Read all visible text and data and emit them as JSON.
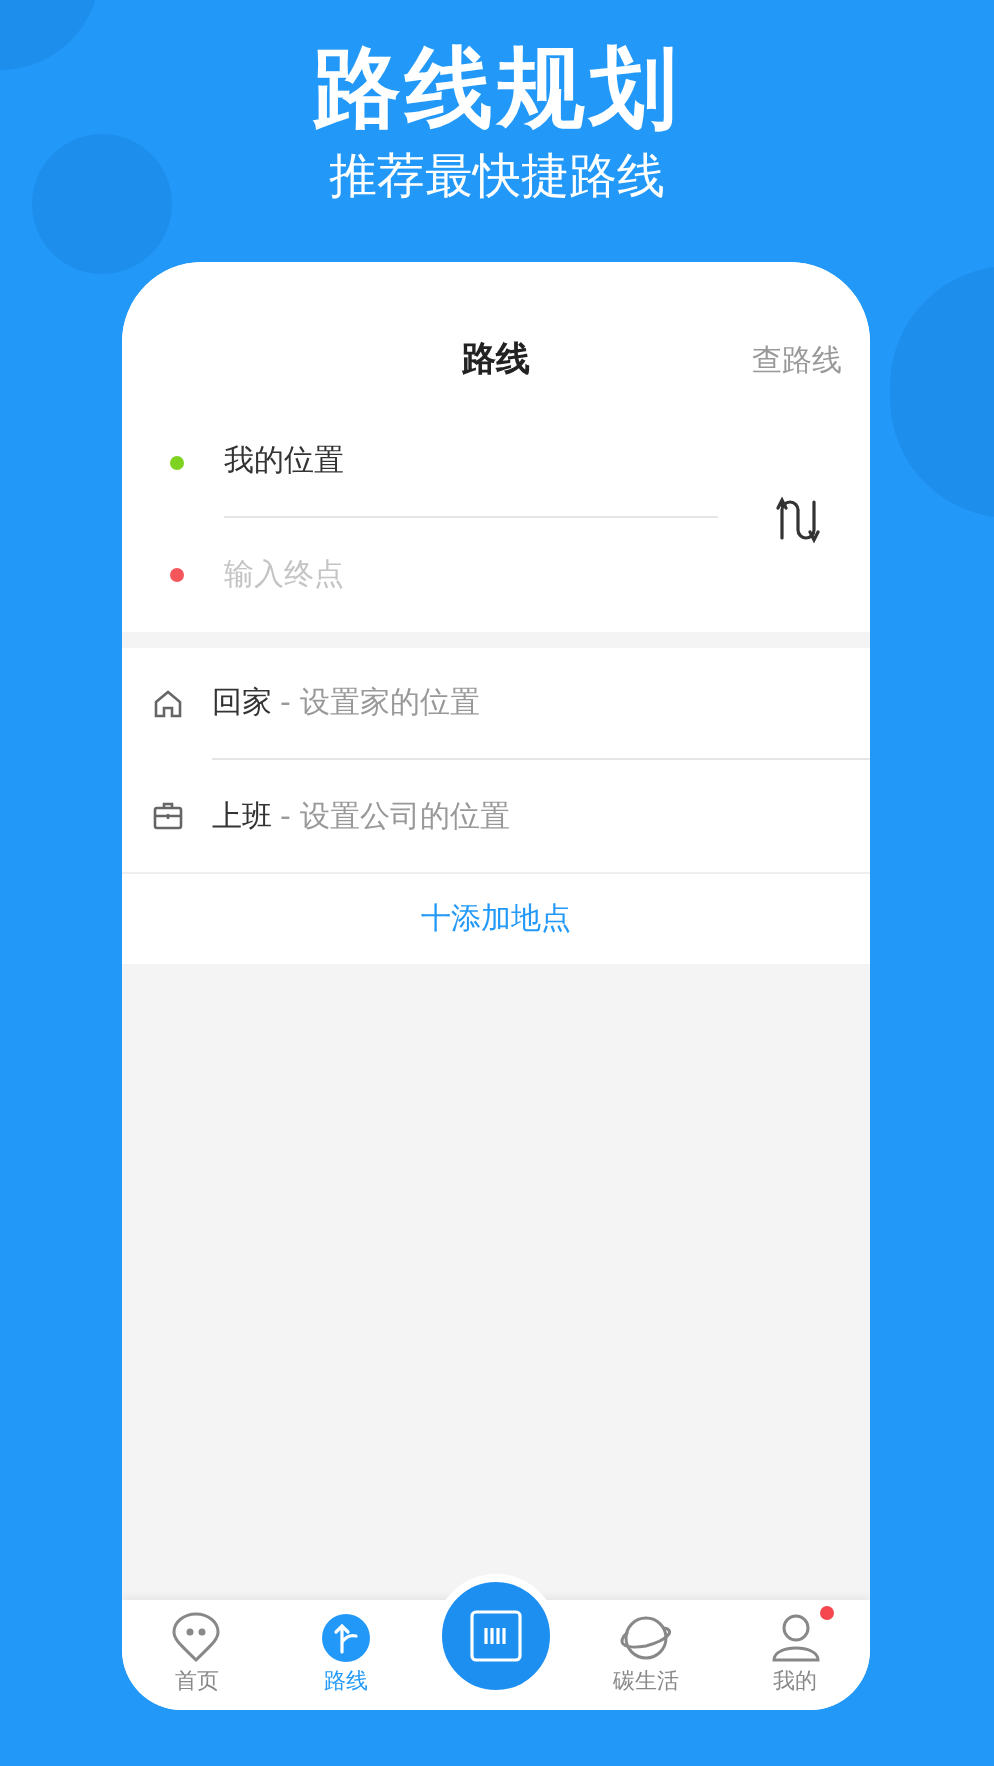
{
  "promo": {
    "title": "路线规划",
    "subtitle": "推荐最快捷路线"
  },
  "header": {
    "title": "路线",
    "action": "查路线"
  },
  "route": {
    "origin": {
      "value": "我的位置",
      "color": "#7ed321"
    },
    "destination": {
      "placeholder": "输入终点",
      "color": "#f5565b"
    }
  },
  "places": [
    {
      "kind": "home",
      "name": "回家",
      "hint": "- 设置家的位置"
    },
    {
      "kind": "work",
      "name": "上班",
      "hint": "- 设置公司的位置"
    }
  ],
  "add_place": "十添加地点",
  "tab_bar": [
    {
      "kind": "home",
      "label": "首页",
      "selected": false,
      "badge": false
    },
    {
      "kind": "route",
      "label": "路线",
      "selected": true,
      "badge": false
    },
    {
      "kind": "scan",
      "selected": false,
      "badge": false
    },
    {
      "kind": "planet",
      "label": "碳生活",
      "selected": false,
      "badge": false
    },
    {
      "kind": "profile",
      "label": "我的",
      "selected": false,
      "badge": true
    }
  ]
}
